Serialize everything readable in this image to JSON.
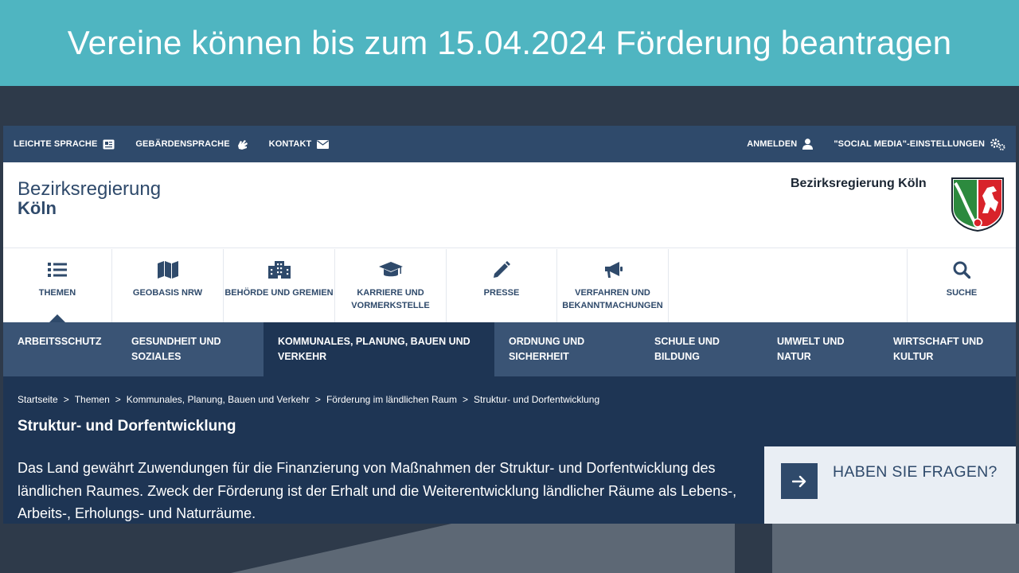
{
  "banner": {
    "title": "Vereine können bis zum 15.04.2024 Förderung beantragen"
  },
  "topbar": {
    "left": [
      {
        "label": "LEICHTE SPRACHE",
        "icon": "easy-language-icon"
      },
      {
        "label": "GEBÄRDENSPRACHE",
        "icon": "sign-language-icon"
      },
      {
        "label": "KONTAKT",
        "icon": "mail-icon"
      }
    ],
    "right": [
      {
        "label": "ANMELDEN",
        "icon": "user-icon"
      },
      {
        "label": "\"SOCIAL MEDIA\"-EINSTELLUNGEN",
        "icon": "gears-icon"
      }
    ]
  },
  "header": {
    "logo_line1": "Bezirksregierung",
    "logo_line2": "Köln",
    "org_name": "Bezirksregierung Köln",
    "crest_icon": "nrw-crest-icon"
  },
  "main_nav": [
    {
      "label": "THEMEN",
      "icon": "list-icon",
      "active": true
    },
    {
      "label": "GEOBASIS NRW",
      "icon": "map-icon"
    },
    {
      "label": "BEHÖRDE UND GREMIEN",
      "icon": "building-icon"
    },
    {
      "label": "KARRIERE UND\nVORMERKSTELLE",
      "icon": "graduation-cap-icon"
    },
    {
      "label": "PRESSE",
      "icon": "pencil-icon"
    },
    {
      "label": "VERFAHREN UND\nBEKANNTMACHUNGEN",
      "icon": "megaphone-icon"
    },
    {
      "label": "SUCHE",
      "icon": "search-icon"
    }
  ],
  "sub_nav": [
    {
      "label": "ARBEITSSCHUTZ"
    },
    {
      "label": "GESUNDHEIT UND\nSOZIALES"
    },
    {
      "label": "KOMMUNALES, PLANUNG, BAUEN UND\nVERKEHR",
      "active": true
    },
    {
      "label": "ORDNUNG UND\nSICHERHEIT"
    },
    {
      "label": "SCHULE UND\nBILDUNG"
    },
    {
      "label": "UMWELT UND\nNATUR"
    },
    {
      "label": "WIRTSCHAFT UND\nKULTUR"
    }
  ],
  "breadcrumb": [
    "Startseite",
    ">",
    "Themen",
    ">",
    "Kommunales, Planung, Bauen und Verkehr",
    ">",
    "Förderung im ländlichen Raum",
    ">",
    "Struktur- und Dorfentwicklung"
  ],
  "page": {
    "title": "Struktur- und Dorfentwicklung",
    "intro": "Das Land gewährt Zuwendungen für die Finanzierung von Maßnahmen der Struktur- und Dorfentwicklung des ländlichen Raumes. Zweck der Förderung ist  der Erhalt und die Weiterentwicklung ländlicher Räume als Lebens-, Arbeits-, Erholungs- und Naturräume."
  },
  "faq": {
    "label": "HABEN SIE FRAGEN?",
    "icon": "arrow-right-icon"
  },
  "colors": {
    "banner": "#4fb5c1",
    "navy": "#2f4a6b",
    "dark_navy": "#1e3554",
    "subnav": "#3a5475"
  }
}
